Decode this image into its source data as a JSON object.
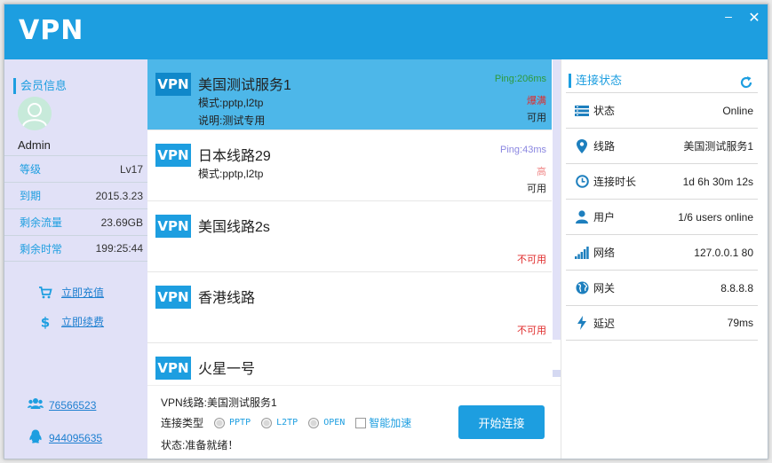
{
  "app": {
    "logo": "VPN",
    "minimize": "–",
    "close": "✕"
  },
  "member": {
    "section_title": "会员信息",
    "username": "Admin",
    "info": [
      {
        "label": "等级",
        "value": "Lv17"
      },
      {
        "label": "到期",
        "value": "2015.3.23"
      },
      {
        "label": "剩余流量",
        "value": "23.69GB"
      },
      {
        "label": "剩余时常",
        "value": "199:25:44"
      }
    ],
    "recharge": "立即充值",
    "renew": "立即续费",
    "contact_group": "76566523",
    "contact_qq": "944095635"
  },
  "servers": [
    {
      "badge": "VPN",
      "name": "美国测试服务1",
      "mode": "模式:pptp,l2tp",
      "desc": "说明:测试专用",
      "ping": "Ping:206ms",
      "load": "爆满",
      "avail": "可用",
      "selected": true
    },
    {
      "badge": "VPN",
      "name": "日本线路29",
      "mode": "模式:pptp,l2tp",
      "desc": "",
      "ping": "Ping:43ms",
      "load": "高",
      "avail": "可用",
      "selected": false
    },
    {
      "badge": "VPN",
      "name": "美国线路2s",
      "mode": "",
      "desc": "",
      "ping": "",
      "load": "",
      "avail": "不可用",
      "selected": false
    },
    {
      "badge": "VPN",
      "name": "香港线路",
      "mode": "",
      "desc": "",
      "ping": "",
      "load": "",
      "avail": "不可用",
      "selected": false
    },
    {
      "badge": "VPN",
      "name": "火星一号",
      "mode": "",
      "desc": "",
      "ping": "",
      "load": "",
      "avail": "",
      "selected": false
    }
  ],
  "connect": {
    "route": "VPN线路:美国测试服务1",
    "type_label": "连接类型",
    "options": [
      "PPTP",
      "L2TP",
      "OPEN"
    ],
    "smart_accel": "智能加速",
    "status": "状态:准备就绪！",
    "button": "开始连接"
  },
  "status_panel": {
    "title": "连接状态",
    "rows": [
      {
        "icon": "status-bars-icon",
        "label": "状态",
        "value": "Online"
      },
      {
        "icon": "location-pin-icon",
        "label": "线路",
        "value": "美国测试服务1"
      },
      {
        "icon": "clock-icon",
        "label": "连接时长",
        "value": "1d 6h 30m 12s"
      },
      {
        "icon": "user-icon",
        "label": "用户",
        "value": "1/6 users online"
      },
      {
        "icon": "signal-icon",
        "label": "网络",
        "value": "127.0.0.1 80"
      },
      {
        "icon": "globe-icon",
        "label": "网关",
        "value": "8.8.8.8"
      },
      {
        "icon": "lightning-icon",
        "label": "延迟",
        "value": "79ms"
      }
    ]
  },
  "colors": {
    "accent": "#1d9ee0",
    "selected_row": "#4db7e9",
    "sidebar_bg": "#e1e1f7",
    "ping_good": "#2e9a3c",
    "ping_medium": "#8a86e0",
    "load_full": "#e02b2b",
    "load_high": "#f08a8a",
    "unavailable": "#e02b2b"
  }
}
